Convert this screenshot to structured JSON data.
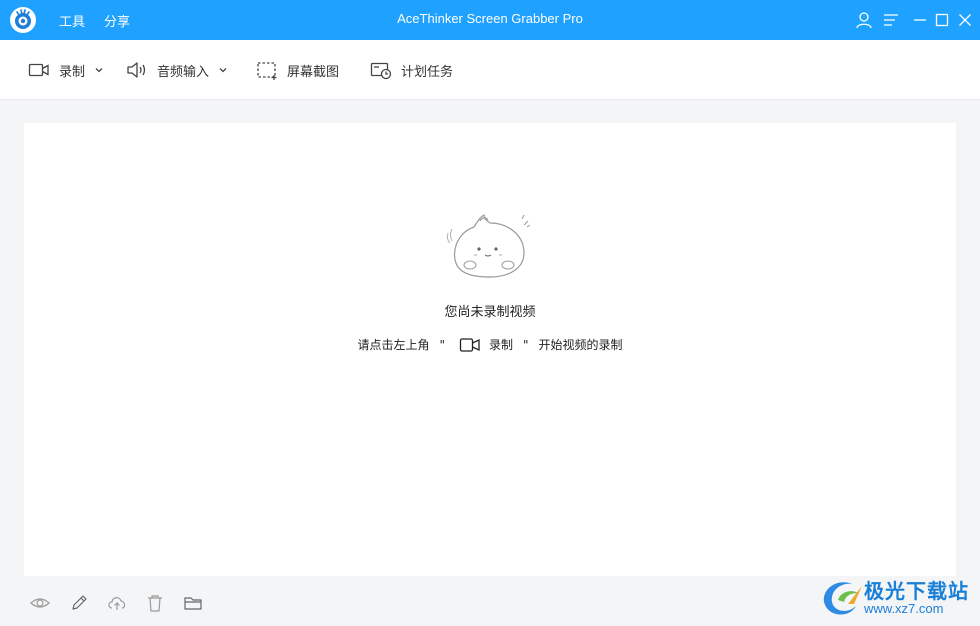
{
  "app": {
    "title": "AceThinker Screen Grabber Pro",
    "accent_color": "#1ea1ff"
  },
  "menu": {
    "tools": "工具",
    "share": "分享"
  },
  "window_controls": [
    "user-icon",
    "menu-icon",
    "minimize-icon",
    "maximize-icon",
    "close-icon"
  ],
  "toolbar": {
    "record": {
      "label": "录制",
      "icon": "video-camera-icon",
      "dropdown": true
    },
    "audio_input": {
      "label": "音频输入",
      "icon": "speaker-icon",
      "dropdown": true
    },
    "screenshot": {
      "label": "屏幕截图",
      "icon": "screenshot-icon"
    },
    "scheduled_task": {
      "label": "计划任务",
      "icon": "schedule-icon"
    }
  },
  "empty_state": {
    "title": "您尚未录制视频",
    "hint_prefix": "请点击左上角",
    "quote_open": "\"",
    "hint_button": "录制",
    "quote_close": "\"",
    "hint_suffix": "开始视频的录制"
  },
  "bottom_actions": [
    "eye-icon",
    "edit-icon",
    "upload-icon",
    "trash-icon",
    "folder-icon"
  ],
  "watermark": {
    "name": "极光下载站",
    "url": "www.xz7.com"
  }
}
